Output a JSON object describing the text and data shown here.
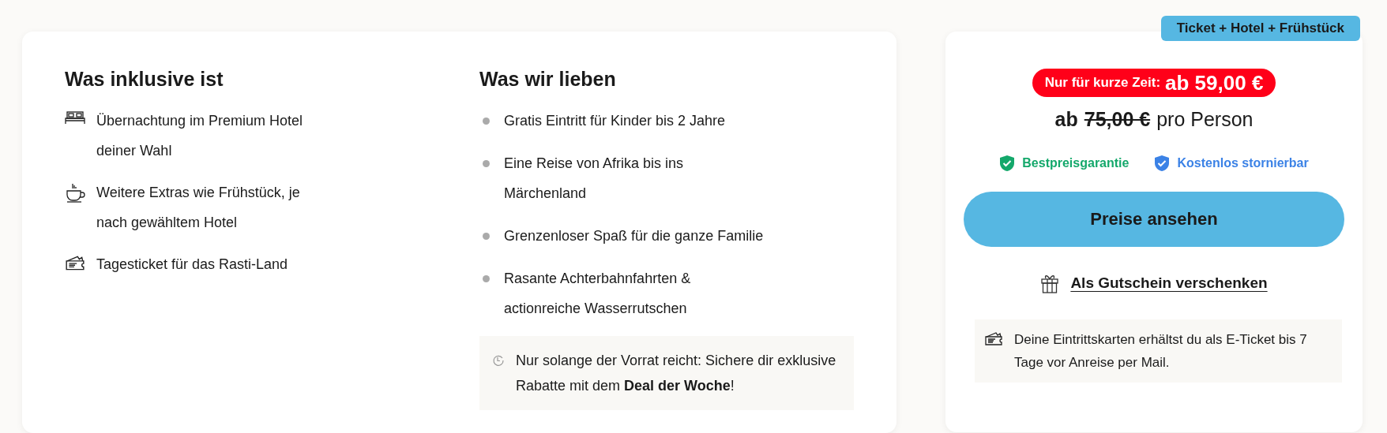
{
  "included": {
    "heading": "Was inklusive ist",
    "items": [
      {
        "kind": "bed",
        "text": "Übernachtung im Premium Hotel deiner Wahl"
      },
      {
        "kind": "cup",
        "text": "Weitere Extras wie Frühstück, je nach gewähltem Hotel"
      },
      {
        "kind": "ticket",
        "text": "Tagesticket für das Rasti-Land"
      }
    ]
  },
  "loved": {
    "heading": "Was wir lieben",
    "items": [
      "Gratis Eintritt für Kinder bis 2 Jahre",
      "Eine Reise von Afrika bis ins Märchenland",
      "Grenzenloser Spaß für die ganze Familie",
      "Rasante Achterbahnfahrten & actionreiche Wasserrutschen"
    ],
    "notice": "Nur solange der Vorrat reicht: Sichere dir exklusive Rabatte mit dem **Deal der Woche**!"
  },
  "offer": {
    "badge": "Ticket + Hotel + Frühstück",
    "promo_label": "Nur für kurze Zeit:",
    "promo_price": "ab 59,00 €",
    "old_price_prefix": "ab",
    "old_price": "75,00 €",
    "old_price_suffix": "pro Person",
    "guarantees": [
      {
        "text": "Bestpreisgarantie",
        "color": "#14a86b"
      },
      {
        "text": "Kostenlos stornierbar",
        "color": "#3b82e6"
      }
    ],
    "button": "Preise ansehen",
    "gift_link": "Als Gutschein verschenken",
    "info": "Deine Eintrittskarten erhältst du als E-Ticket bis 7 Tage vor Anreise per Mail."
  }
}
